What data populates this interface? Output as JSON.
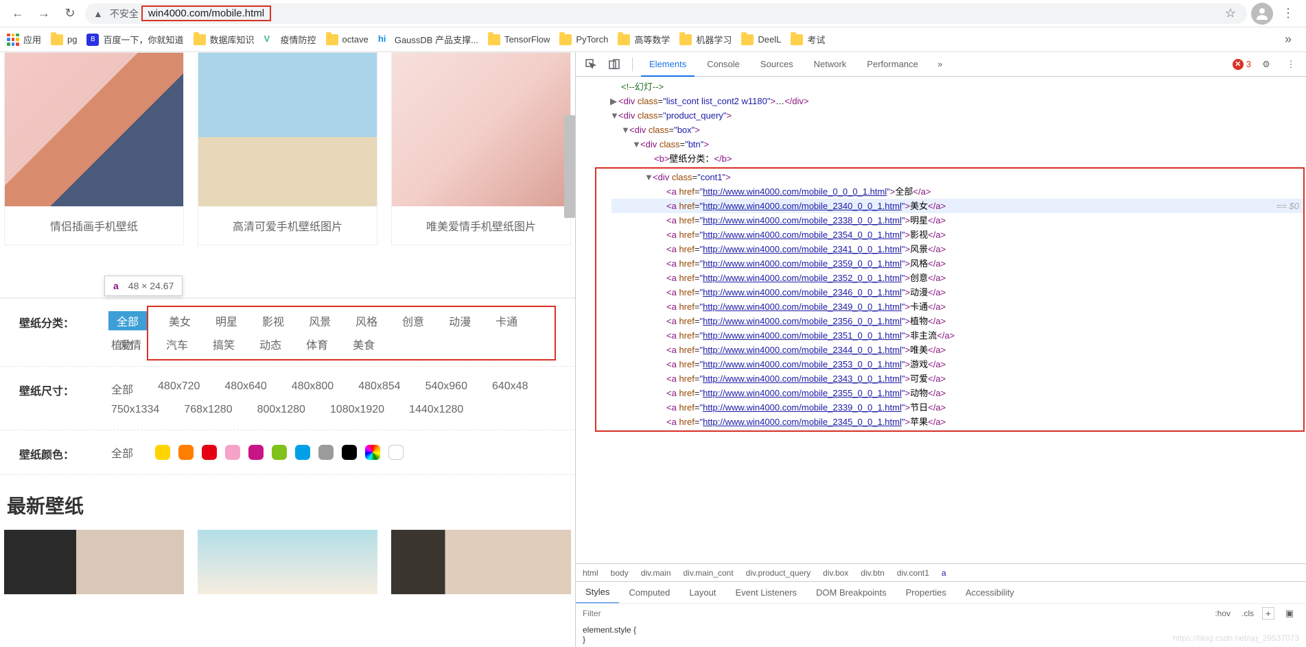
{
  "browser": {
    "url_prefix": "不安全",
    "url_display_host": "win4000.com",
    "url_display_path": "/mobile.html",
    "bookmarks": {
      "apps": "应用",
      "items": [
        "pg",
        "百度一下，你就知道",
        "数据库知识",
        "疫情防控",
        "octave",
        "GaussDB 产品支撑...",
        "TensorFlow",
        "PyTorch",
        "高等数学",
        "机器学习",
        "DeelL",
        "考试"
      ]
    }
  },
  "tooltip": {
    "tag": "a",
    "dims": "48 × 24.67"
  },
  "cards": [
    {
      "caption": "情侣插画手机壁纸"
    },
    {
      "caption": "高清可爱手机壁纸图片"
    },
    {
      "caption": "唯美爱情手机壁纸图片"
    }
  ],
  "filters": {
    "category_label": "壁纸分类：",
    "category_all": "全部",
    "categories": [
      "美女",
      "明星",
      "影视",
      "风景",
      "风格",
      "创意",
      "动漫",
      "卡通",
      "植物",
      "爱情",
      "汽车",
      "搞笑",
      "动态",
      "体育",
      "美食"
    ],
    "size_label": "壁纸尺寸：",
    "size_all": "全部",
    "sizes": [
      "480x720",
      "480x640",
      "480x800",
      "480x854",
      "540x960",
      "640x48",
      "750x1334",
      "768x1280",
      "800x1280",
      "1080x1920",
      "1440x1280"
    ],
    "color_label": "壁纸颜色：",
    "color_all": "全部",
    "colors": [
      "#ffd400",
      "#ff7f00",
      "#e60012",
      "#f5a3c7",
      "#c71585",
      "#7fc21c",
      "#00a0e9",
      "#9b9b9b",
      "#000000",
      "rainbow",
      "#ffffff"
    ]
  },
  "latest_heading": "最新壁纸",
  "devtools": {
    "tabs": [
      "Elements",
      "Console",
      "Sources",
      "Network",
      "Performance"
    ],
    "error_count": "3",
    "comment": "幻灯",
    "list_cont_class": "list_cont list_cont2 w1180",
    "product_query_class": "product_query",
    "box_class": "box",
    "btn_class": "btn",
    "b_text": "壁纸分类：",
    "cont1_class": "cont1",
    "links": [
      {
        "href": "http://www.win4000.com/mobile_0_0_0_1.html",
        "text": "全部"
      },
      {
        "href": "http://www.win4000.com/mobile_2340_0_0_1.html",
        "text": "美女"
      },
      {
        "href": "http://www.win4000.com/mobile_2338_0_0_1.html",
        "text": "明星"
      },
      {
        "href": "http://www.win4000.com/mobile_2354_0_0_1.html",
        "text": "影视"
      },
      {
        "href": "http://www.win4000.com/mobile_2341_0_0_1.html",
        "text": "风景"
      },
      {
        "href": "http://www.win4000.com/mobile_2359_0_0_1.html",
        "text": "风格"
      },
      {
        "href": "http://www.win4000.com/mobile_2352_0_0_1.html",
        "text": "创意"
      },
      {
        "href": "http://www.win4000.com/mobile_2346_0_0_1.html",
        "text": "动漫"
      },
      {
        "href": "http://www.win4000.com/mobile_2349_0_0_1.html",
        "text": "卡通"
      },
      {
        "href": "http://www.win4000.com/mobile_2356_0_0_1.html",
        "text": "植物"
      },
      {
        "href": "http://www.win4000.com/mobile_2351_0_0_1.html",
        "text": "非主流"
      },
      {
        "href": "http://www.win4000.com/mobile_2344_0_0_1.html",
        "text": "唯美"
      },
      {
        "href": "http://www.win4000.com/mobile_2353_0_0_1.html",
        "text": "游戏"
      },
      {
        "href": "http://www.win4000.com/mobile_2343_0_0_1.html",
        "text": "可爱"
      },
      {
        "href": "http://www.win4000.com/mobile_2355_0_0_1.html",
        "text": "动物"
      },
      {
        "href": "http://www.win4000.com/mobile_2339_0_0_1.html",
        "text": "节日"
      },
      {
        "href": "http://www.win4000.com/mobile_2345_0_0_1.html",
        "text": "苹果"
      }
    ],
    "eq0": "== $0",
    "breadcrumb": [
      "html",
      "body",
      "div.main",
      "div.main_cont",
      "div.product_query",
      "div.box",
      "div.btn",
      "div.cont1",
      "a"
    ],
    "styles_tabs": [
      "Styles",
      "Computed",
      "Layout",
      "Event Listeners",
      "DOM Breakpoints",
      "Properties",
      "Accessibility"
    ],
    "filter_placeholder": "Filter",
    "hov": ":hov",
    "cls": ".cls",
    "element_style": "element.style {",
    "brace_close": "}"
  },
  "watermark": "https://blog.csdn.net/qq_29537073"
}
